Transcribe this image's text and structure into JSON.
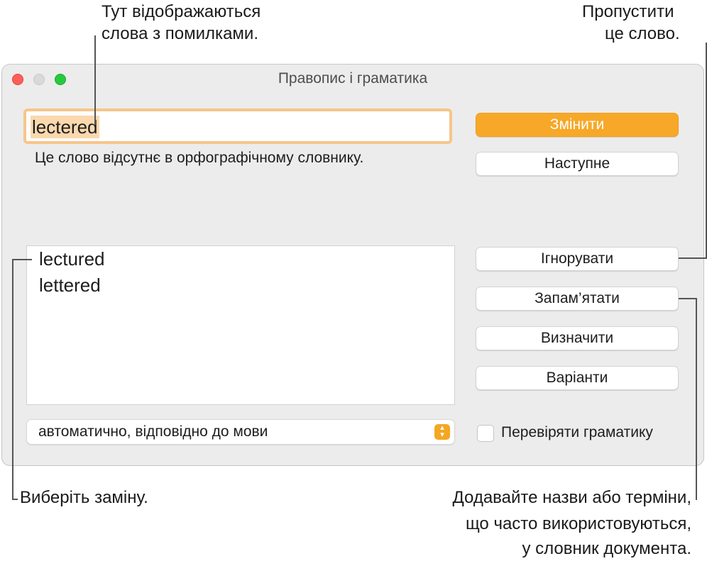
{
  "callouts": {
    "misspelled_line1": "Тут відображаються",
    "misspelled_line2": "слова з помилками.",
    "ignore_line1": "Пропустити",
    "ignore_line2": "це слово.",
    "choose": "Виберіть заміну.",
    "learn_line1": "Додавайте назви або терміни,",
    "learn_line2": "що часто використовуються,",
    "learn_line3": "у словник документа."
  },
  "window": {
    "title": "Правопис і граматика",
    "misspelled_word": "lectered",
    "status_message": "Це слово відсутнє в орфографічному словнику.",
    "guesses": [
      "lectured",
      "lettered"
    ],
    "language_select": "автоматично, відповідно до мови",
    "buttons": {
      "change": "Змінити",
      "find_next": "Наступне",
      "ignore": "Ігнорувати",
      "learn": "Запам’ятати",
      "define": "Визначити",
      "guess": "Варіанти"
    },
    "check_grammar_label": "Перевіряти граматику",
    "check_grammar_checked": false
  },
  "colors": {
    "accent": "#f7a828",
    "focus_ring": "#f7c58a",
    "selection": "#fbd8ad",
    "close": "#fe5f57",
    "zoom": "#27c93f"
  }
}
